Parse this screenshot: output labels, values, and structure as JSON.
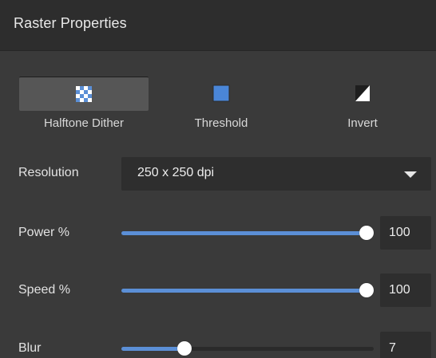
{
  "panel": {
    "title": "Raster Properties"
  },
  "modes": [
    {
      "label": "Halftone Dither",
      "icon": "halftone-dither-icon",
      "active": true
    },
    {
      "label": "Threshold",
      "icon": "threshold-icon",
      "active": false
    },
    {
      "label": "Invert",
      "icon": "invert-icon",
      "active": false
    }
  ],
  "resolution": {
    "label": "Resolution",
    "value": "250 x 250 dpi",
    "icon": "chevron-down-icon"
  },
  "power": {
    "label": "Power %",
    "value": "100",
    "fraction": 1.0
  },
  "speed": {
    "label": "Speed %",
    "value": "100",
    "fraction": 1.0
  },
  "blur": {
    "label": "Blur",
    "value": "7",
    "fraction": 0.25
  },
  "colors": {
    "accent": "#5b8fd6",
    "panel_bg": "#3a3a3a",
    "header_bg": "#2d2d2d",
    "field_bg": "#2e2e2e",
    "active_button_bg": "#565656"
  }
}
